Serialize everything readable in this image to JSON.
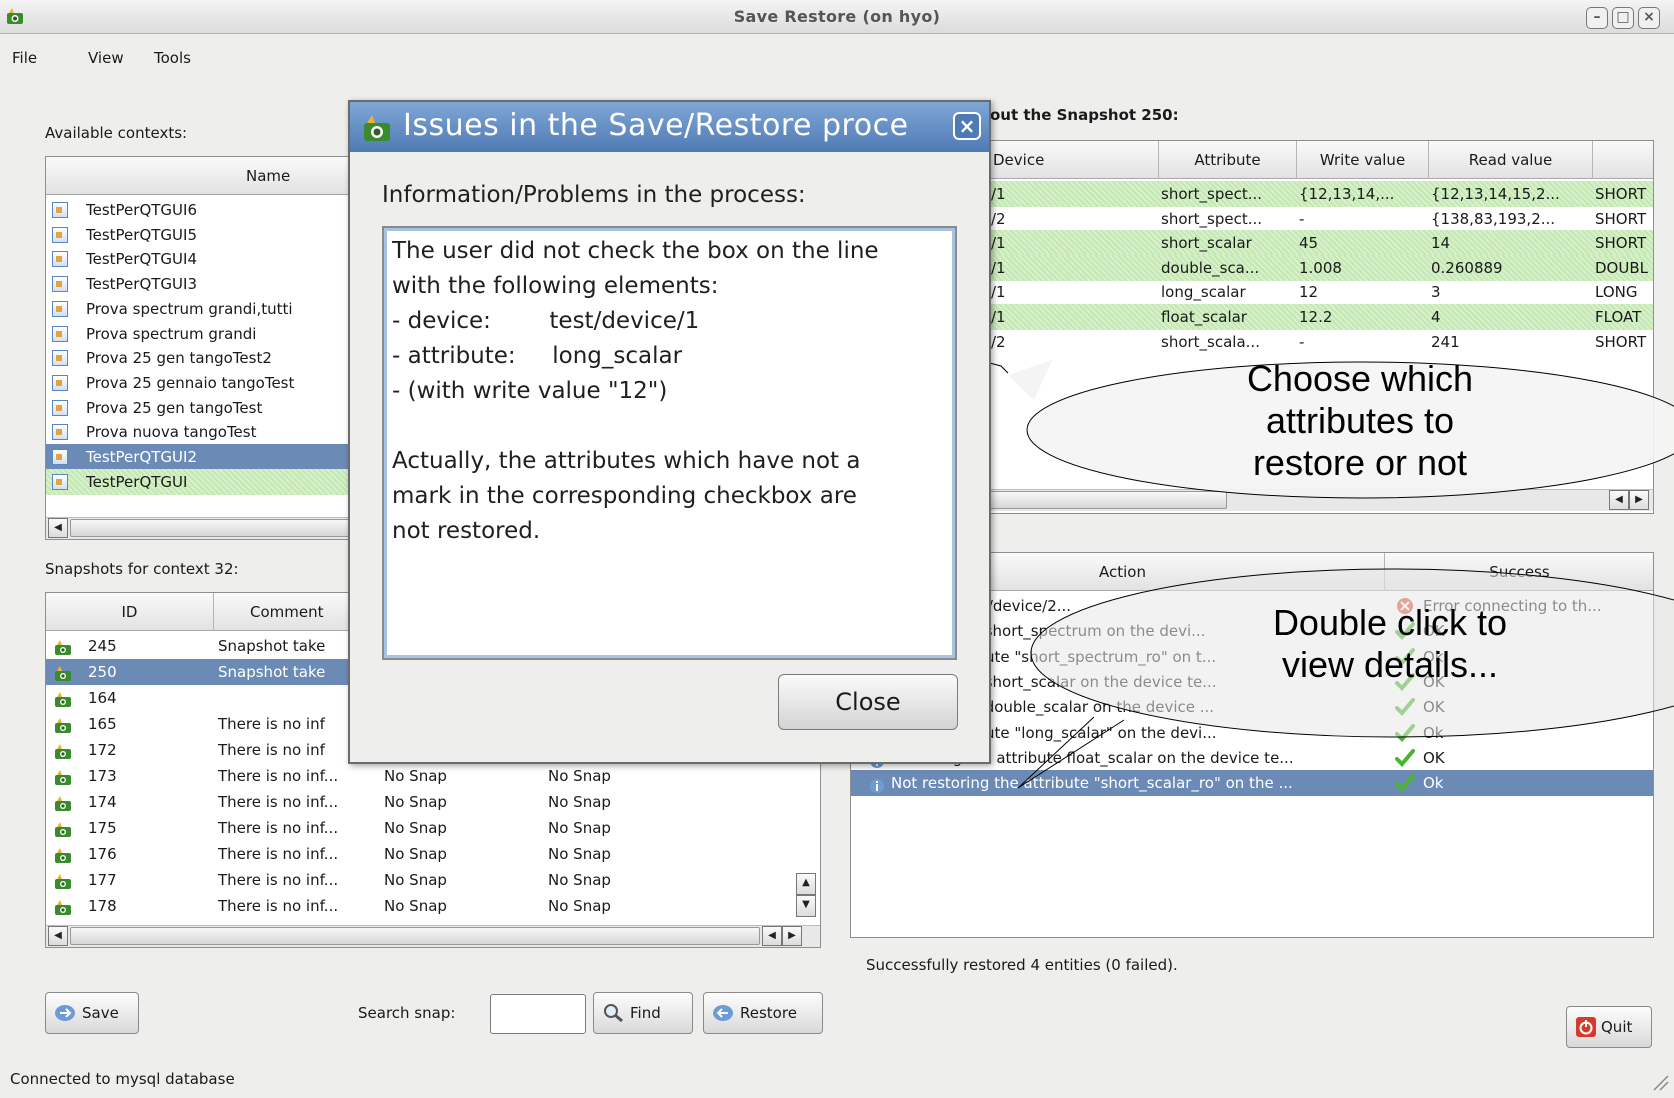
{
  "window": {
    "title": "Save Restore (on hyo)"
  },
  "menu": [
    "File",
    "View",
    "Tools"
  ],
  "contexts": {
    "label": "Available contexts:",
    "header": "Name",
    "items": [
      "TestPerQTGUI6",
      "TestPerQTGUI5",
      "TestPerQTGUI4",
      "TestPerQTGUI3",
      "Prova spectrum grandi,tutti",
      "Prova spectrum grandi",
      "Prova 25 gen tangoTest2",
      "Prova 25 gennaio tangoTest",
      "Prova 25 gen tangoTest",
      "Prova nuova tangoTest",
      "TestPerQTGUI2",
      "TestPerQTGUI"
    ],
    "selected_index": 10,
    "green_index": 11
  },
  "snapshots": {
    "label": "Snapshots for context 32:",
    "headers": [
      "ID",
      "Comment"
    ],
    "rows": [
      [
        "245",
        "Snapshot take",
        "",
        ""
      ],
      [
        "250",
        "Snapshot take",
        "",
        ""
      ],
      [
        "164",
        "",
        "",
        ""
      ],
      [
        "165",
        "There is no inf",
        "",
        ""
      ],
      [
        "172",
        "There is no inf",
        "",
        ""
      ],
      [
        "173",
        "There is no inf...",
        "No Snap",
        "No Snap"
      ],
      [
        "174",
        "There is no inf...",
        "No Snap",
        "No Snap"
      ],
      [
        "175",
        "There is no inf...",
        "No Snap",
        "No Snap"
      ],
      [
        "176",
        "There is no inf...",
        "No Snap",
        "No Snap"
      ],
      [
        "177",
        "There is no inf...",
        "No Snap",
        "No Snap"
      ],
      [
        "178",
        "There is no inf...",
        "No Snap",
        "No Snap"
      ]
    ],
    "selected_index": 1
  },
  "snapshot_detail": {
    "label": "out the Snapshot 250:",
    "headers": [
      "Device",
      "Attribute",
      "Write value",
      "Read value",
      ""
    ],
    "rows": [
      [
        "/1",
        "short_spect...",
        "{12,13,14,...",
        "{12,13,14,15,2...",
        "SHORT"
      ],
      [
        "/2",
        "short_spect...",
        "-",
        "{138,83,193,2...",
        "SHORT"
      ],
      [
        "/1",
        "short_scalar",
        "45",
        "14",
        "SHORT"
      ],
      [
        "/1",
        "double_sca...",
        "1.008",
        "0.260889",
        "DOUBL"
      ],
      [
        "/1",
        "long_scalar",
        "12",
        "3",
        "LONG"
      ],
      [
        "/1",
        "float_scalar",
        "12.2",
        "4",
        "FLOAT"
      ],
      [
        "/2",
        "short_scala...",
        "-",
        "241",
        "SHORT"
      ]
    ],
    "green_rows": [
      0,
      2,
      3,
      5
    ]
  },
  "actions": {
    "headers": [
      "Action",
      "Success"
    ],
    "rows": [
      {
        "action": "e device test/device/2...",
        "success": "Error connecting to th...",
        "status": "error"
      },
      {
        "action": "he attribute short_spectrum on the devi...",
        "success": "OK",
        "status": "ok"
      },
      {
        "action": "ng the attribute \"short_spectrum_ro\" on t...",
        "success": "Ok",
        "status": "ok"
      },
      {
        "action": "he attribute short_scalar on the device te...",
        "success": "OK",
        "status": "ok"
      },
      {
        "action": "he attribute double_scalar on the device ...",
        "success": "OK",
        "status": "ok"
      },
      {
        "action": "ng the attribute \"long_scalar\" on the devi...",
        "success": "Ok",
        "status": "ok"
      },
      {
        "action": "Restoring the attribute float_scalar on the device te...",
        "success": "OK",
        "status": "ok"
      },
      {
        "action": "Not restoring the attribute \"short_scalar_ro\" on the ...",
        "success": "Ok",
        "status": "ok"
      }
    ],
    "selected_index": 7,
    "status_text": "Successfully restored 4 entities (0 failed)."
  },
  "buttons": {
    "save": "Save",
    "search_label": "Search snap:",
    "find": "Find",
    "restore": "Restore",
    "quit": "Quit"
  },
  "statusbar": "Connected to mysql database",
  "dialog": {
    "title": "Issues in the Save/Restore proce",
    "heading": "Information/Problems in the process:",
    "lines": [
      "The user did not check the box on the line",
      "with the following elements:",
      "- device:        test/device/1",
      "- attribute:     long_scalar",
      "- (with write value \"12\")",
      "",
      "Actually, the attributes which have not a",
      "mark in the corresponding checkbox are",
      "not restored."
    ],
    "close": "Close"
  },
  "callouts": {
    "choose": [
      "Choose which",
      "attributes to",
      "restore or not"
    ],
    "double": [
      "Double click to",
      "view details..."
    ]
  },
  "colors": {
    "selection": "#6b8bb6",
    "checked_row": "#c3e8b1",
    "dialog_title": "#4f7bb4"
  }
}
